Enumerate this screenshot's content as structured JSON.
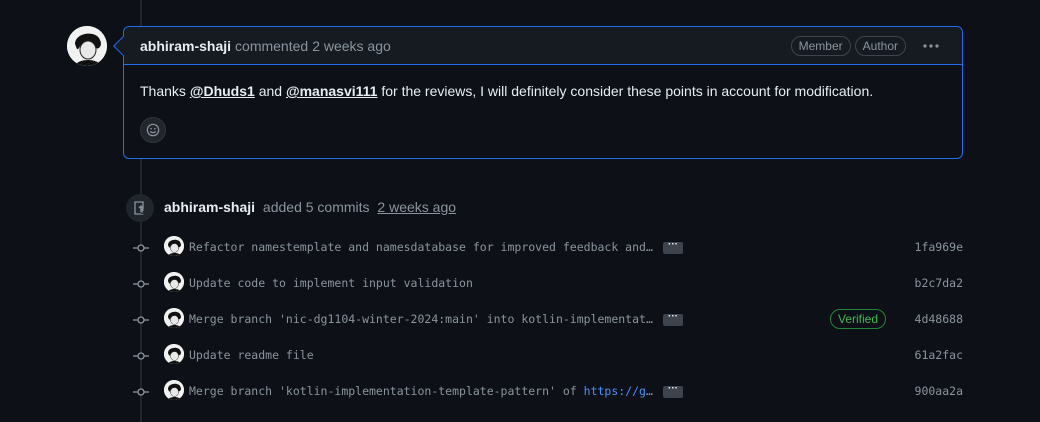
{
  "comment": {
    "author": "abhiram-shaji",
    "action": "commented",
    "time": "2 weeks ago",
    "badges": [
      "Member",
      "Author"
    ],
    "body": {
      "prefix": "Thanks ",
      "mention1": "@Dhuds1",
      "middle": " and ",
      "mention2": "@manasvi111",
      "suffix": " for the reviews, I will definitely consider these points in account for modification."
    }
  },
  "commits_event": {
    "author": "abhiram-shaji",
    "action": "added 5 commits",
    "time": "2 weeks ago"
  },
  "commits": [
    {
      "message": "Refactor namestemplate and namesdatabase for improved feedback and co…",
      "link": "",
      "sha": "1fa969e",
      "verified": "",
      "has_more": true
    },
    {
      "message": "Update code to implement input validation",
      "link": "",
      "sha": "b2c7da2",
      "verified": "",
      "has_more": false
    },
    {
      "message": "Merge branch 'nic-dg1104-winter-2024:main' into kotlin-implementation…",
      "link": "",
      "sha": "4d48688",
      "verified": "Verified",
      "has_more": true
    },
    {
      "message": "Update readme file",
      "link": "",
      "sha": "61a2fac",
      "verified": "",
      "has_more": false
    },
    {
      "message": "Merge branch 'kotlin-implementation-template-pattern' of ",
      "link": "https://gith…",
      "sha": "900aa2a",
      "verified": "",
      "has_more": true
    }
  ],
  "more_glyph": "···",
  "kebab_glyph": "•••",
  "colors": {
    "accent": "#1f6feb",
    "link": "#4493f8",
    "verified": "#3fb950",
    "muted": "#8b949e"
  },
  "icons": [
    "kebab-icon",
    "smiley-icon",
    "push-icon",
    "commit-node-icon"
  ]
}
